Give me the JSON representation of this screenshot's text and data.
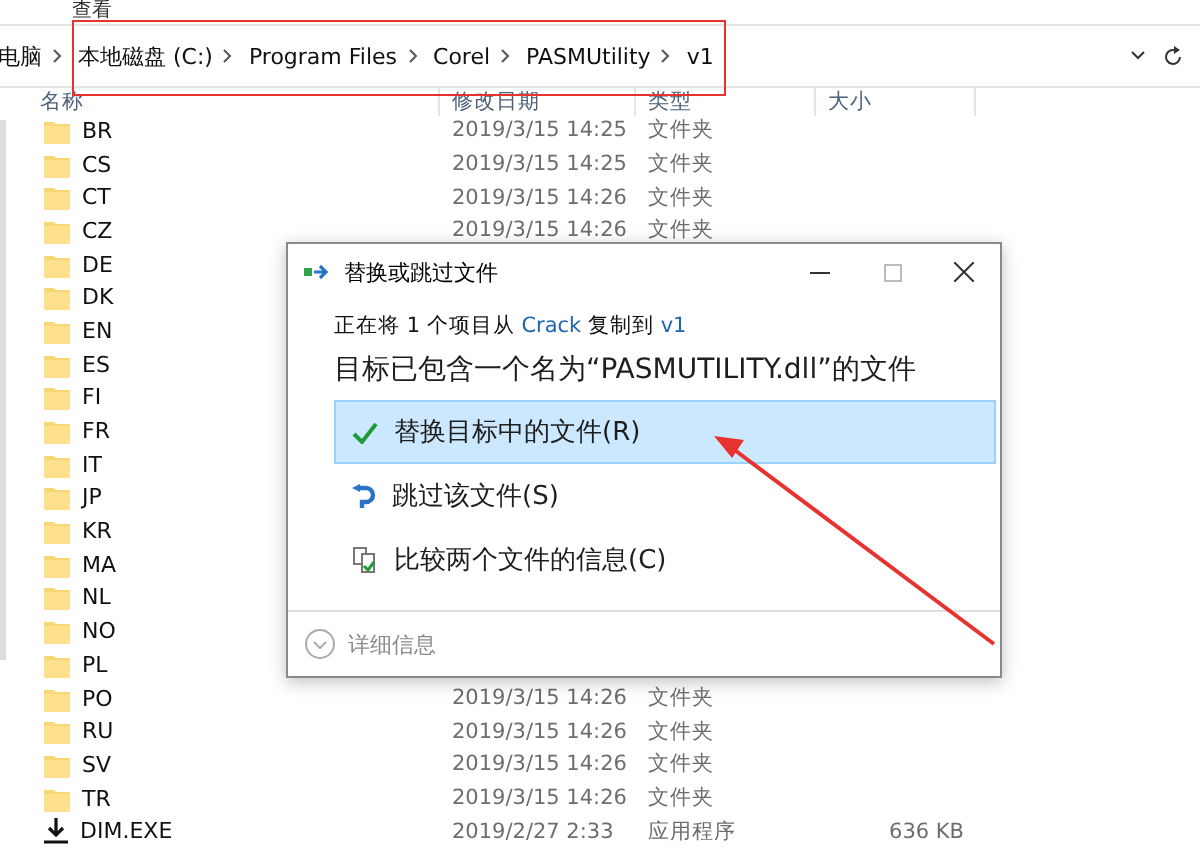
{
  "ribbon": {
    "tab": "查看"
  },
  "address_bar": {
    "path": [
      "电脑",
      "本地磁盘 (C:)",
      "Program Files",
      "Corel",
      "PASMUtility",
      "v1"
    ]
  },
  "columns": [
    "名称",
    "修改日期",
    "类型",
    "大小"
  ],
  "rows": [
    {
      "kind": "folder",
      "name": "BR",
      "date": "2019/3/15 14:25",
      "type": "文件夹"
    },
    {
      "kind": "folder",
      "name": "CS",
      "date": "2019/3/15 14:25",
      "type": "文件夹"
    },
    {
      "kind": "folder",
      "name": "CT",
      "date": "2019/3/15 14:26",
      "type": "文件夹"
    },
    {
      "kind": "folder",
      "name": "CZ",
      "date": "2019/3/15 14:26",
      "type": "文件夹"
    },
    {
      "kind": "folder",
      "name": "DE"
    },
    {
      "kind": "folder",
      "name": "DK"
    },
    {
      "kind": "folder",
      "name": "EN"
    },
    {
      "kind": "folder",
      "name": "ES"
    },
    {
      "kind": "folder",
      "name": "FI"
    },
    {
      "kind": "folder",
      "name": "FR"
    },
    {
      "kind": "folder",
      "name": "IT"
    },
    {
      "kind": "folder",
      "name": "JP"
    },
    {
      "kind": "folder",
      "name": "KR"
    },
    {
      "kind": "folder",
      "name": "MA"
    },
    {
      "kind": "folder",
      "name": "NL"
    },
    {
      "kind": "folder",
      "name": "NO"
    },
    {
      "kind": "folder",
      "name": "PL"
    },
    {
      "kind": "folder",
      "name": "PO",
      "date": "2019/3/15 14:26",
      "type": "文件夹"
    },
    {
      "kind": "folder",
      "name": "RU",
      "date": "2019/3/15 14:26",
      "type": "文件夹"
    },
    {
      "kind": "folder",
      "name": "SV",
      "date": "2019/3/15 14:26",
      "type": "文件夹"
    },
    {
      "kind": "folder",
      "name": "TR",
      "date": "2019/3/15 14:26",
      "type": "文件夹"
    },
    {
      "kind": "app",
      "name": "DIM.EXE",
      "date": "2019/2/27 2:33",
      "type": "应用程序",
      "size": "636 KB"
    }
  ],
  "dialog": {
    "title": "替换或跳过文件",
    "info": {
      "prefix": "正在将 1 个项目从 ",
      "source": "Crack",
      "middle": " 复制到 ",
      "target": "v1"
    },
    "heading": "目标已包含一个名为“PASMUTILITY.dll”的文件",
    "options": [
      {
        "kind": "replace",
        "label": "替换目标中的文件(R)",
        "selected": true
      },
      {
        "kind": "skip",
        "label": "跳过该文件(S)",
        "selected": false
      },
      {
        "kind": "compare",
        "label": "比较两个文件的信息(C)",
        "selected": false
      }
    ],
    "details": "详细信息"
  }
}
